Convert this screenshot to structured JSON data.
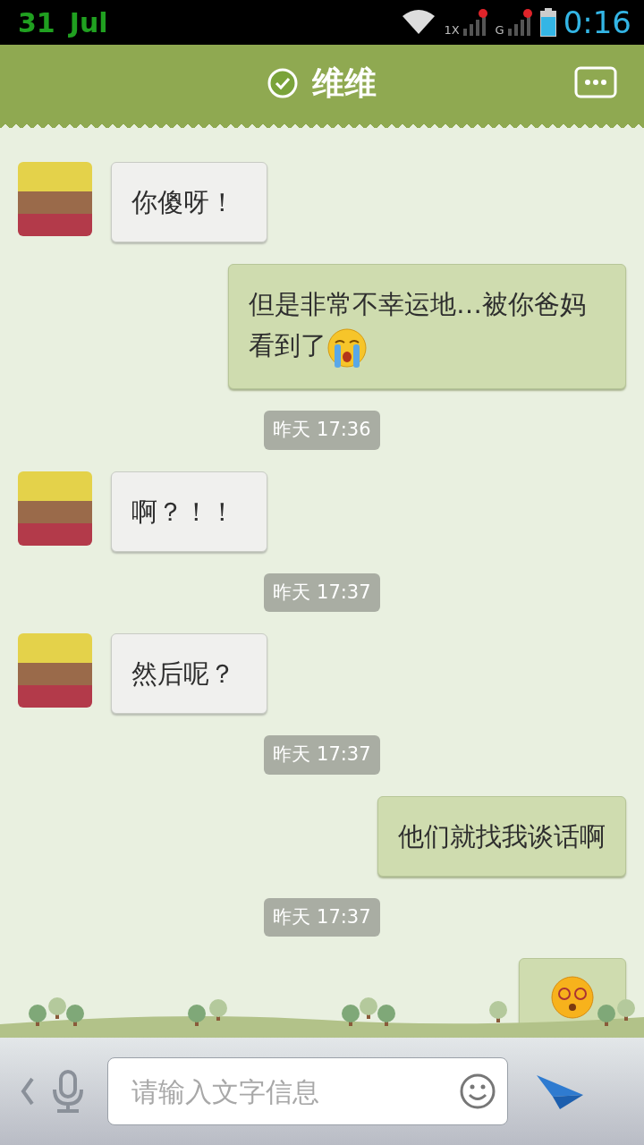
{
  "status_bar": {
    "day": "31",
    "month": "Jul",
    "signal_1_label": "1X",
    "signal_2_label": "G",
    "time": "0:16"
  },
  "header": {
    "title": "维维",
    "verified": true
  },
  "messages": [
    {
      "kind": "in",
      "text": "你傻呀！"
    },
    {
      "kind": "out",
      "text": "但是非常不幸运地…被你爸妈看到了",
      "trailing_emoji": true
    },
    {
      "kind": "time",
      "text": "昨天 17:36"
    },
    {
      "kind": "in",
      "text": "啊？！！"
    },
    {
      "kind": "time",
      "text": "昨天 17:37"
    },
    {
      "kind": "in",
      "text": "然后呢？"
    },
    {
      "kind": "time",
      "text": "昨天 17:37"
    },
    {
      "kind": "out",
      "text": "他们就找我谈话啊",
      "trailing_emoji": false
    },
    {
      "kind": "time",
      "text": "昨天 17:37"
    },
    {
      "kind": "sticker"
    }
  ],
  "input": {
    "placeholder": "请输入文字信息"
  }
}
